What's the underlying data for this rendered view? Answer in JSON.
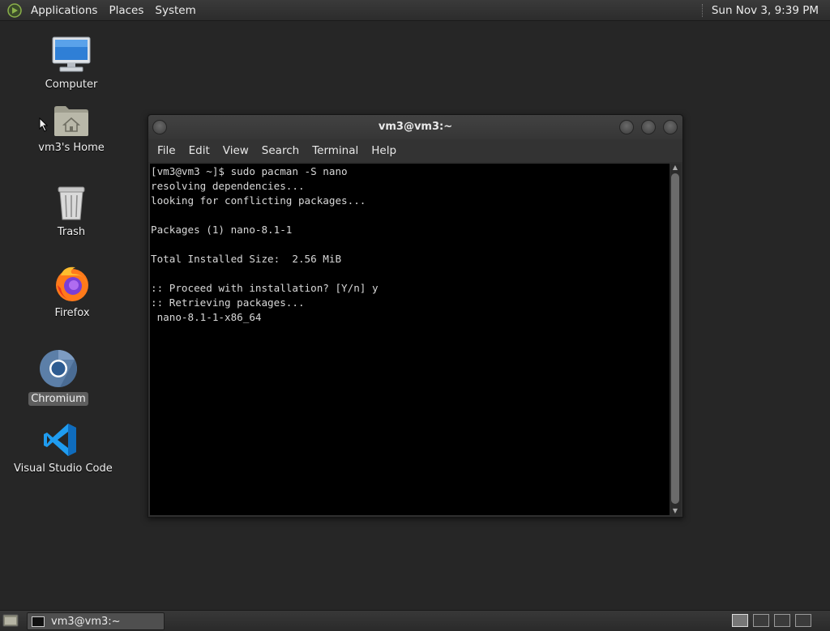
{
  "top_panel": {
    "menus": [
      "Applications",
      "Places",
      "System"
    ],
    "clock": "Sun Nov 3, 9:39 PM"
  },
  "desktop": {
    "icons": [
      {
        "label": "Computer",
        "icon": "computer-icon"
      },
      {
        "label": "vm3's Home",
        "icon": "home-folder-icon"
      },
      {
        "label": "Trash",
        "icon": "trash-icon"
      },
      {
        "label": "Firefox",
        "icon": "firefox-icon"
      },
      {
        "label": "Chromium",
        "icon": "chromium-icon",
        "selected": true
      },
      {
        "label": "Visual Studio Code",
        "icon": "vscode-icon"
      }
    ]
  },
  "terminal": {
    "title": "vm3@vm3:~",
    "menu": [
      "File",
      "Edit",
      "View",
      "Search",
      "Terminal",
      "Help"
    ],
    "lines": [
      "[vm3@vm3 ~]$ sudo pacman -S nano",
      "resolving dependencies...",
      "looking for conflicting packages...",
      "",
      "Packages (1) nano-8.1-1",
      "",
      "Total Installed Size:  2.56 MiB",
      "",
      ":: Proceed with installation? [Y/n] y",
      ":: Retrieving packages...",
      " nano-8.1-1-x86_64"
    ]
  },
  "bottom_panel": {
    "task": "vm3@vm3:~"
  },
  "colors": {
    "desktop_bg": "#262626",
    "terminal_bg": "#000000",
    "terminal_fg": "#d8d8d8",
    "panel_bg": "#333333"
  }
}
